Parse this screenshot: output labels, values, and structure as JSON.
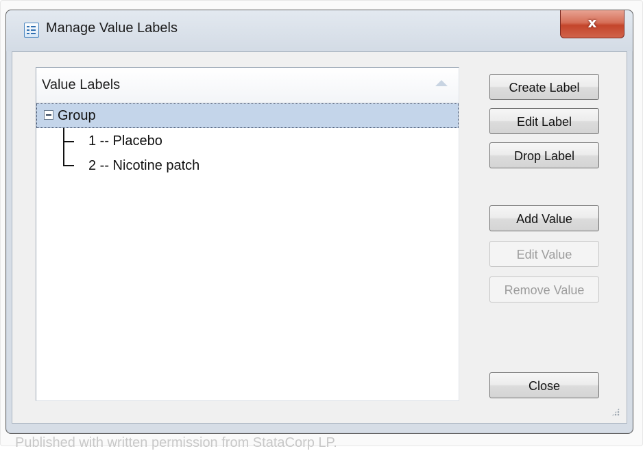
{
  "window": {
    "title": "Manage Value Labels",
    "close_glyph": "x",
    "icon": "window-list-icon"
  },
  "tree": {
    "header_label": "Value Labels",
    "sort_icon": "sort-ascending-icon",
    "items": [
      {
        "label": "Group",
        "expanded": true,
        "selected": true
      },
      {
        "label": "1 -- Placebo"
      },
      {
        "label": "2 -- Nicotine patch"
      }
    ]
  },
  "buttons": {
    "create_label": "Create Label",
    "edit_label": "Edit Label",
    "drop_label": "Drop Label",
    "add_value": "Add Value",
    "edit_value": "Edit Value",
    "remove_value": "Remove Value",
    "close": "Close"
  },
  "disabled_buttons": [
    "Edit Value",
    "Remove Value"
  ],
  "caption": "Published with written permission from StataCorp LP.",
  "colors": {
    "selection": "#c4d5ea",
    "close_button": "#c4452b",
    "disabled_text": "#9c9c9c"
  }
}
